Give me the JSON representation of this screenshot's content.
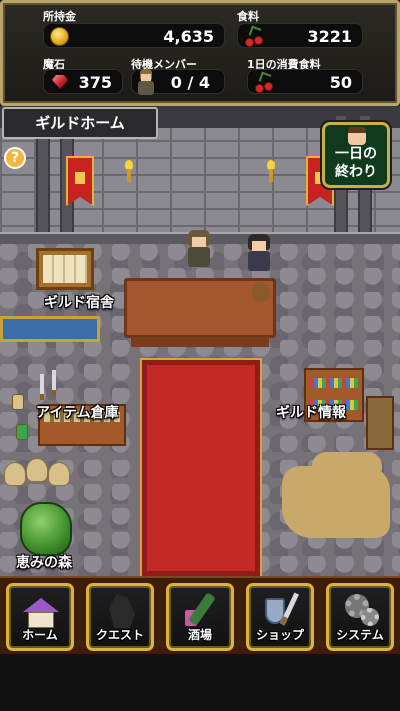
{
  "hud": {
    "money_label": "所持金",
    "money_value": "4,635",
    "food_label": "食料",
    "food_value": "3221",
    "magic_stone_label": "魔石",
    "magic_stone_value": "375",
    "members_label": "待機メンバー",
    "members_value": "0 / 4",
    "daily_food_label": "1日の消費食料",
    "daily_food_value": "50"
  },
  "scene": {
    "title": "ギルドホーム",
    "help_glyph": "?",
    "end_day_label": "一日の終わり",
    "end_day_line1": "一日の",
    "end_day_line2": "終わり",
    "places": {
      "dormitory": "ギルド宿舎",
      "item_storage": "アイテム倉庫",
      "guild_info": "ギルド情報",
      "forest": "恵みの森"
    }
  },
  "nav": {
    "home": "ホーム",
    "quest": "クエスト",
    "bar": "酒場",
    "shop": "ショップ",
    "system": "システム"
  },
  "colors": {
    "hud_border": "#b9a46a",
    "nav_border": "#d8b43c",
    "nav_bg": "#3f1d0c",
    "carpet": "#c32a26",
    "end_day_bg": "#0f3a1e"
  },
  "icons": {
    "money": "gold-coin-icon",
    "food": "cherry-icon",
    "magic_stone": "red-gem-icon",
    "members": "member-portrait-icon",
    "daily_food": "cherry-icon",
    "help": "question-mark-icon"
  }
}
